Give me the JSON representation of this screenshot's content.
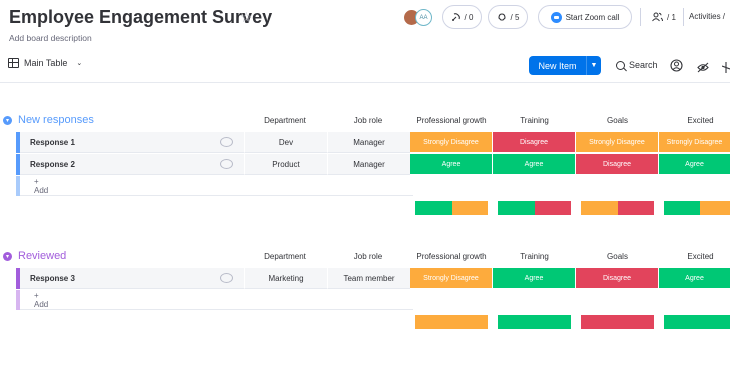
{
  "header": {
    "title": "Employee Engagement Survey",
    "description": "Add board description",
    "avatar_badge": "AA",
    "integrations_count": "/ 0",
    "automations_count": "/ 5",
    "zoom_label": "Start Zoom call",
    "members_count": "/ 1",
    "activities_label": "Activities /"
  },
  "toolbar": {
    "view_label": "Main Table",
    "new_item_label": "New Item",
    "search_label": "Search"
  },
  "colors": {
    "green": "#00c875",
    "red": "#e2445c",
    "orange": "#fdab3d",
    "blue": "#579bfc",
    "purple": "#a25ddc"
  },
  "columns": [
    "Department",
    "Job role",
    "Professional growth",
    "Training",
    "Goals",
    "Excited"
  ],
  "groups": [
    {
      "title": "New responses",
      "color": "#579bfc",
      "headers": [
        "Department",
        "Job role",
        "Professional growth",
        "Training",
        "Goals",
        "Excited"
      ],
      "rows": [
        {
          "name": "Response 1",
          "department": "Dev",
          "job_role": "Manager",
          "growth": "Strongly Disagree",
          "training": "Disagree",
          "goals": "Strongly Disagree",
          "excited": "Strongly Disagree"
        },
        {
          "name": "Response 2",
          "department": "Product",
          "job_role": "Manager",
          "growth": "Agree",
          "training": "Agree",
          "goals": "Disagree",
          "excited": "Agree"
        }
      ],
      "add_label": "+ Add"
    },
    {
      "title": "Reviewed",
      "color": "#a25ddc",
      "headers": [
        "Department",
        "Job role",
        "Professional growth",
        "Training",
        "Goals",
        "Excited"
      ],
      "rows": [
        {
          "name": "Response 3",
          "department": "Marketing",
          "job_role": "Team member",
          "growth": "Strongly Disagree",
          "training": "Agree",
          "goals": "Disagree",
          "excited": "Agree"
        }
      ],
      "add_label": "+ Add"
    }
  ],
  "summaries": {
    "group1": {
      "growth": [
        [
          "green",
          0.5
        ],
        [
          "orange",
          0.5
        ]
      ],
      "training": [
        [
          "green",
          0.5
        ],
        [
          "red",
          0.5
        ]
      ],
      "goals": [
        [
          "orange",
          0.5
        ],
        [
          "red",
          0.5
        ]
      ],
      "excited": [
        [
          "green",
          0.5
        ],
        [
          "orange",
          0.5
        ]
      ]
    },
    "group2": {
      "growth": [
        [
          "orange",
          1
        ]
      ],
      "training": [
        [
          "green",
          1
        ]
      ],
      "goals": [
        [
          "red",
          1
        ]
      ],
      "excited": [
        [
          "green",
          1
        ]
      ]
    }
  }
}
